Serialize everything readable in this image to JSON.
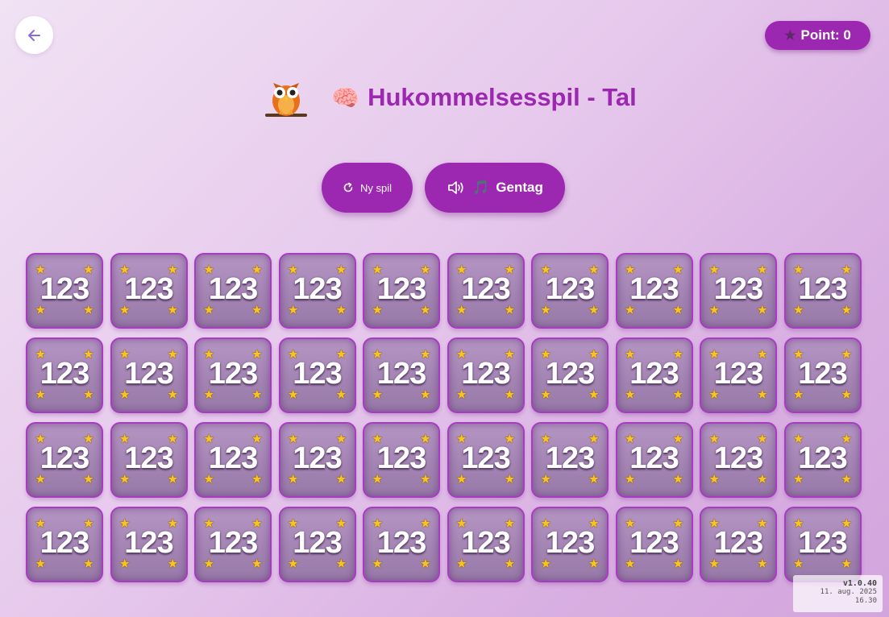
{
  "header": {
    "back_icon": "arrow-left-icon",
    "points_label": "Point: 0",
    "points_icon": "star-icon"
  },
  "title": {
    "mascot_icon": "owl-icon",
    "brain_icon": "🧠",
    "text": "Hukommelsesspil - Tal"
  },
  "controls": {
    "new_game": {
      "icon": "refresh-icon",
      "label": "Ny spil"
    },
    "repeat": {
      "icon": "speaker-icon",
      "music_icon": "🎵",
      "label": "Gentag"
    }
  },
  "cards": {
    "count": 40,
    "label": "123",
    "star_icon": "star-icon",
    "star_glyph": "★"
  },
  "version": {
    "number": "v1.0.40",
    "date": "11. aug. 2025",
    "time": "16.30"
  },
  "colors": {
    "accent": "#9c27b0",
    "card_border": "#a73bc1",
    "star": "#f7c325"
  }
}
